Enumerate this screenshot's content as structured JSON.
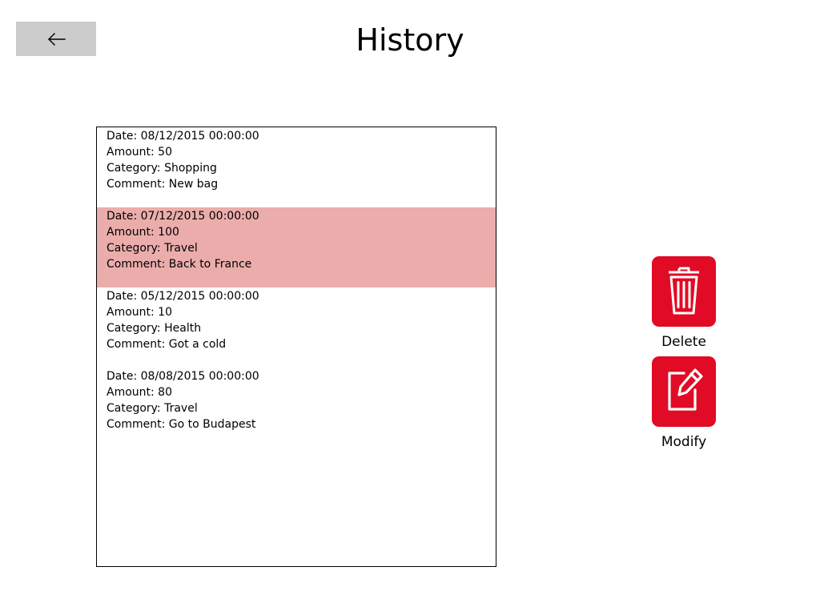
{
  "header": {
    "title": "History",
    "back_icon": "arrow-left-icon"
  },
  "history": {
    "items": [
      {
        "date": "Date: 08/12/2015 00:00:00",
        "amount": "Amount: 50",
        "category": "Category: Shopping",
        "comment": "Comment: New bag",
        "selected": false
      },
      {
        "date": "Date: 07/12/2015 00:00:00",
        "amount": "Amount: 100",
        "category": "Category: Travel",
        "comment": "Comment: Back to France",
        "selected": true
      },
      {
        "date": "Date: 05/12/2015 00:00:00",
        "amount": "Amount: 10",
        "category": "Category: Health",
        "comment": "Comment: Got a cold",
        "selected": false
      },
      {
        "date": "Date: 08/08/2015 00:00:00",
        "amount": "Amount: 80",
        "category": "Category: Travel",
        "comment": "Comment: Go to Budapest",
        "selected": false
      }
    ]
  },
  "actions": {
    "delete": {
      "label": "Delete",
      "icon": "trash-icon"
    },
    "modify": {
      "label": "Modify",
      "icon": "edit-icon"
    }
  },
  "colors": {
    "accent": "#e10b26",
    "selection": "#ebadab",
    "back_button": "#cccccc"
  }
}
